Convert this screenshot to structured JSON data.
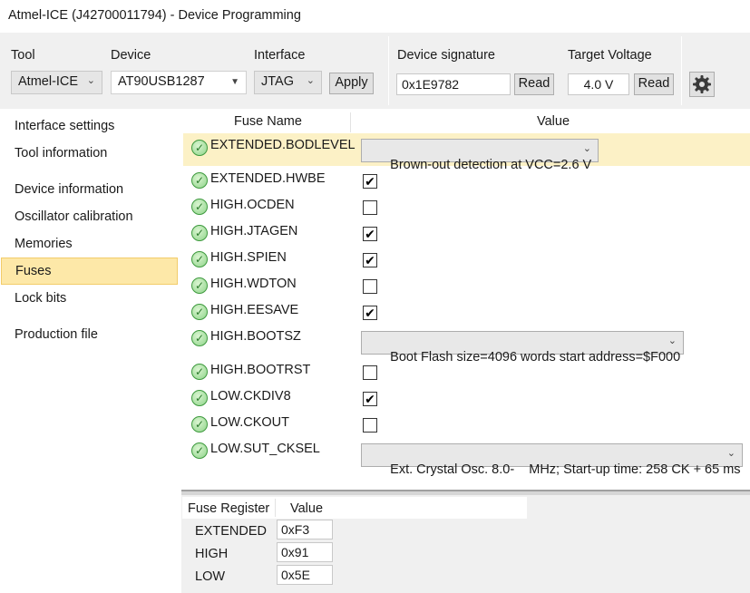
{
  "window": {
    "title": "Atmel-ICE (J42700011794) - Device Programming"
  },
  "toolbar": {
    "tool_label": "Tool",
    "tool_value": "Atmel-ICE",
    "device_label": "Device",
    "device_value": "AT90USB1287",
    "interface_label": "Interface",
    "interface_value": "JTAG",
    "apply_label": "Apply",
    "signature_label": "Device signature",
    "signature_value": "0x1E9782",
    "signature_read_label": "Read",
    "voltage_label": "Target Voltage",
    "voltage_value": "4.0 V",
    "voltage_read_label": "Read",
    "settings_icon": "gear-icon"
  },
  "sidebar": {
    "items": [
      {
        "label": "Interface settings",
        "selected": false
      },
      {
        "label": "Tool information",
        "selected": false
      },
      {
        "label": "Device information",
        "selected": false
      },
      {
        "label": "Oscillator calibration",
        "selected": false
      },
      {
        "label": "Memories",
        "selected": false
      },
      {
        "label": "Fuses",
        "selected": true
      },
      {
        "label": "Lock bits",
        "selected": false
      },
      {
        "label": "Production file",
        "selected": false
      }
    ],
    "selected_color": "#fde8a8"
  },
  "fuses": {
    "header_name": "Fuse Name",
    "header_value": "Value",
    "status_icon": "check-circle-icon",
    "rows": [
      {
        "name": "EXTENDED.BODLEVEL",
        "type": "select",
        "value": "Brown-out detection at VCC=2.6 V"
      },
      {
        "name": "EXTENDED.HWBE",
        "type": "checkbox",
        "checked": true
      },
      {
        "name": "HIGH.OCDEN",
        "type": "checkbox",
        "checked": false
      },
      {
        "name": "HIGH.JTAGEN",
        "type": "checkbox",
        "checked": true
      },
      {
        "name": "HIGH.SPIEN",
        "type": "checkbox",
        "checked": true
      },
      {
        "name": "HIGH.WDTON",
        "type": "checkbox",
        "checked": false
      },
      {
        "name": "HIGH.EESAVE",
        "type": "checkbox",
        "checked": true
      },
      {
        "name": "HIGH.BOOTSZ",
        "type": "select",
        "value": "Boot Flash size=4096 words start address=$F000"
      },
      {
        "name": "HIGH.BOOTRST",
        "type": "checkbox",
        "checked": false
      },
      {
        "name": "LOW.CKDIV8",
        "type": "checkbox",
        "checked": true
      },
      {
        "name": "LOW.CKOUT",
        "type": "checkbox",
        "checked": false
      },
      {
        "name": "LOW.SUT_CKSEL",
        "type": "select",
        "value": "Ext. Crystal Osc. 8.0-    MHz; Start-up time: 258 CK + 65 ms"
      }
    ],
    "highlight_color": "#fcf1c6"
  },
  "registers": {
    "header_name": "Fuse Register",
    "header_value": "Value",
    "rows": [
      {
        "name": "EXTENDED",
        "value": "0xF3"
      },
      {
        "name": "HIGH",
        "value": "0x91"
      },
      {
        "name": "LOW",
        "value": "0x5E"
      }
    ]
  }
}
